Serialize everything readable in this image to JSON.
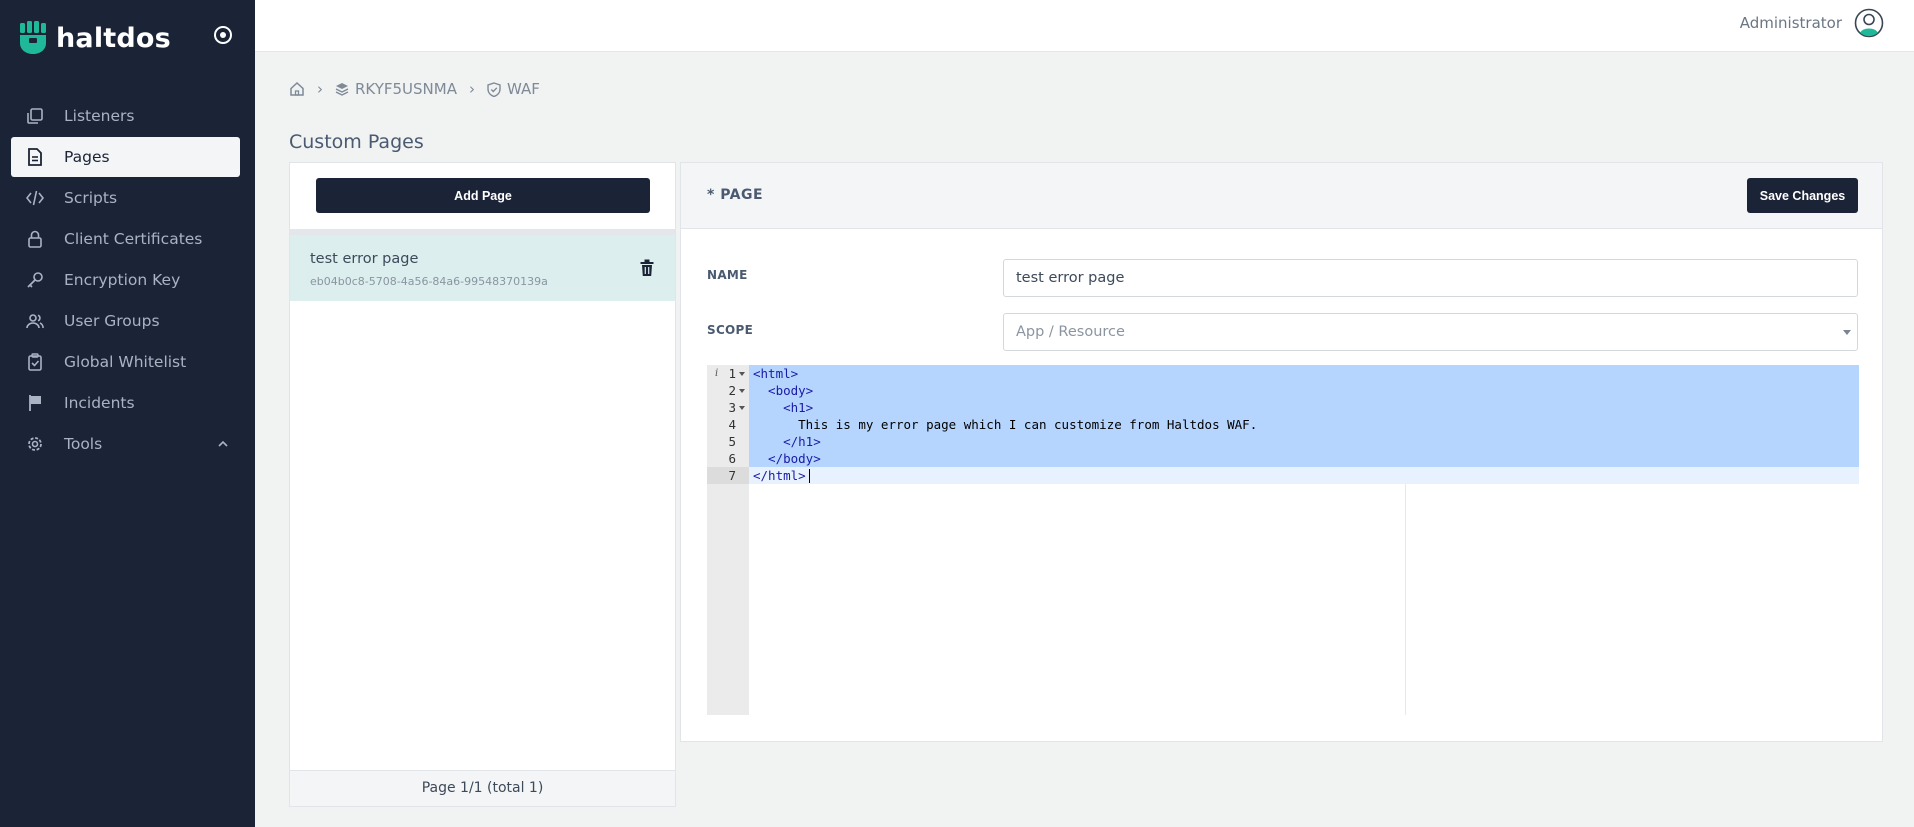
{
  "brand": {
    "name": "haltdos"
  },
  "sidebar": {
    "items": [
      {
        "label": "Listeners",
        "icon": "copy-icon"
      },
      {
        "label": "Pages",
        "icon": "file-icon",
        "active": true
      },
      {
        "label": "Scripts",
        "icon": "code-icon"
      },
      {
        "label": "Client Certificates",
        "icon": "lock-icon"
      },
      {
        "label": "Encryption Key",
        "icon": "key-icon"
      },
      {
        "label": "User Groups",
        "icon": "users-icon"
      },
      {
        "label": "Global Whitelist",
        "icon": "clipboard-check-icon"
      },
      {
        "label": "Incidents",
        "icon": "flag-icon"
      },
      {
        "label": "Tools",
        "icon": "gear-icon",
        "expanded": true
      }
    ]
  },
  "topbar": {
    "user_name": "Administrator"
  },
  "breadcrumb": {
    "home_icon": "home-icon",
    "items": [
      "RKYF5USNMA",
      "WAF"
    ]
  },
  "page_title": "Custom Pages",
  "list_panel": {
    "add_button": "Add Page",
    "items": [
      {
        "title": "test error page",
        "id": "eb04b0c8-5708-4a56-84a6-99548370139a"
      }
    ],
    "pagination": "Page 1/1 (total 1)"
  },
  "editor_panel": {
    "title": "* PAGE",
    "save_button": "Save Changes",
    "name_label": "NAME",
    "name_value": "test error page",
    "scope_label": "SCOPE",
    "scope_placeholder": "App / Resource",
    "code_lines": [
      {
        "n": "1",
        "text": "<html>"
      },
      {
        "n": "2",
        "text": "  <body>"
      },
      {
        "n": "3",
        "text": "    <h1>"
      },
      {
        "n": "4",
        "text": "      This is my error page which I can customize from Haltdos WAF."
      },
      {
        "n": "5",
        "text": "    </h1>"
      },
      {
        "n": "6",
        "text": "  </body>"
      },
      {
        "n": "7",
        "text": "</html>"
      }
    ]
  },
  "colors": {
    "sidebar_bg": "#1b2437",
    "accent": "#1fb99a",
    "selected_row": "#dceeed",
    "selection": "#b5d5ff"
  }
}
